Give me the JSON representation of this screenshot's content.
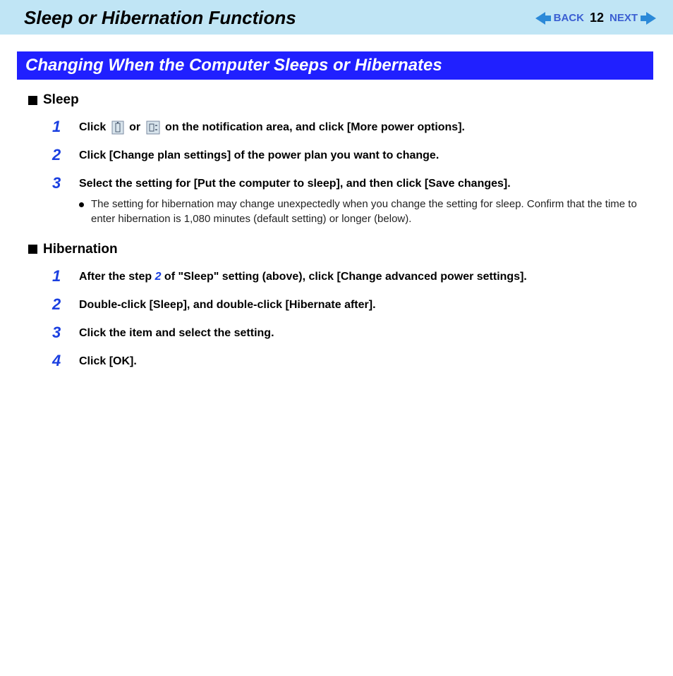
{
  "header": {
    "title": "Sleep or Hibernation Functions",
    "back_label": "BACK",
    "next_label": "NEXT",
    "page_number": "12"
  },
  "banner": "Changing When the Computer Sleeps or Hibernates",
  "sleep": {
    "heading": "Sleep",
    "steps": {
      "s1_pre": "Click ",
      "s1_mid": " or ",
      "s1_post": " on the notification area, and click [More power options].",
      "s2": "Click [Change plan settings] of the power plan you want to change.",
      "s3": "Select the setting for [Put the computer to sleep], and then click [Save changes].",
      "note": "The setting for hibernation may change unexpectedly when you change the setting for sleep. Confirm that the time to enter hibernation is 1,080 minutes (default setting) or longer (below)."
    }
  },
  "hibernation": {
    "heading": "Hibernation",
    "steps": {
      "s1_pre": "After the step ",
      "s1_ref": "2",
      "s1_post": " of \"Sleep\" setting (above), click [Change advanced power settings].",
      "s2": "Double-click [Sleep], and double-click [Hibernate after].",
      "s3": "Click the item and select the setting.",
      "s4": "Click [OK]."
    }
  }
}
